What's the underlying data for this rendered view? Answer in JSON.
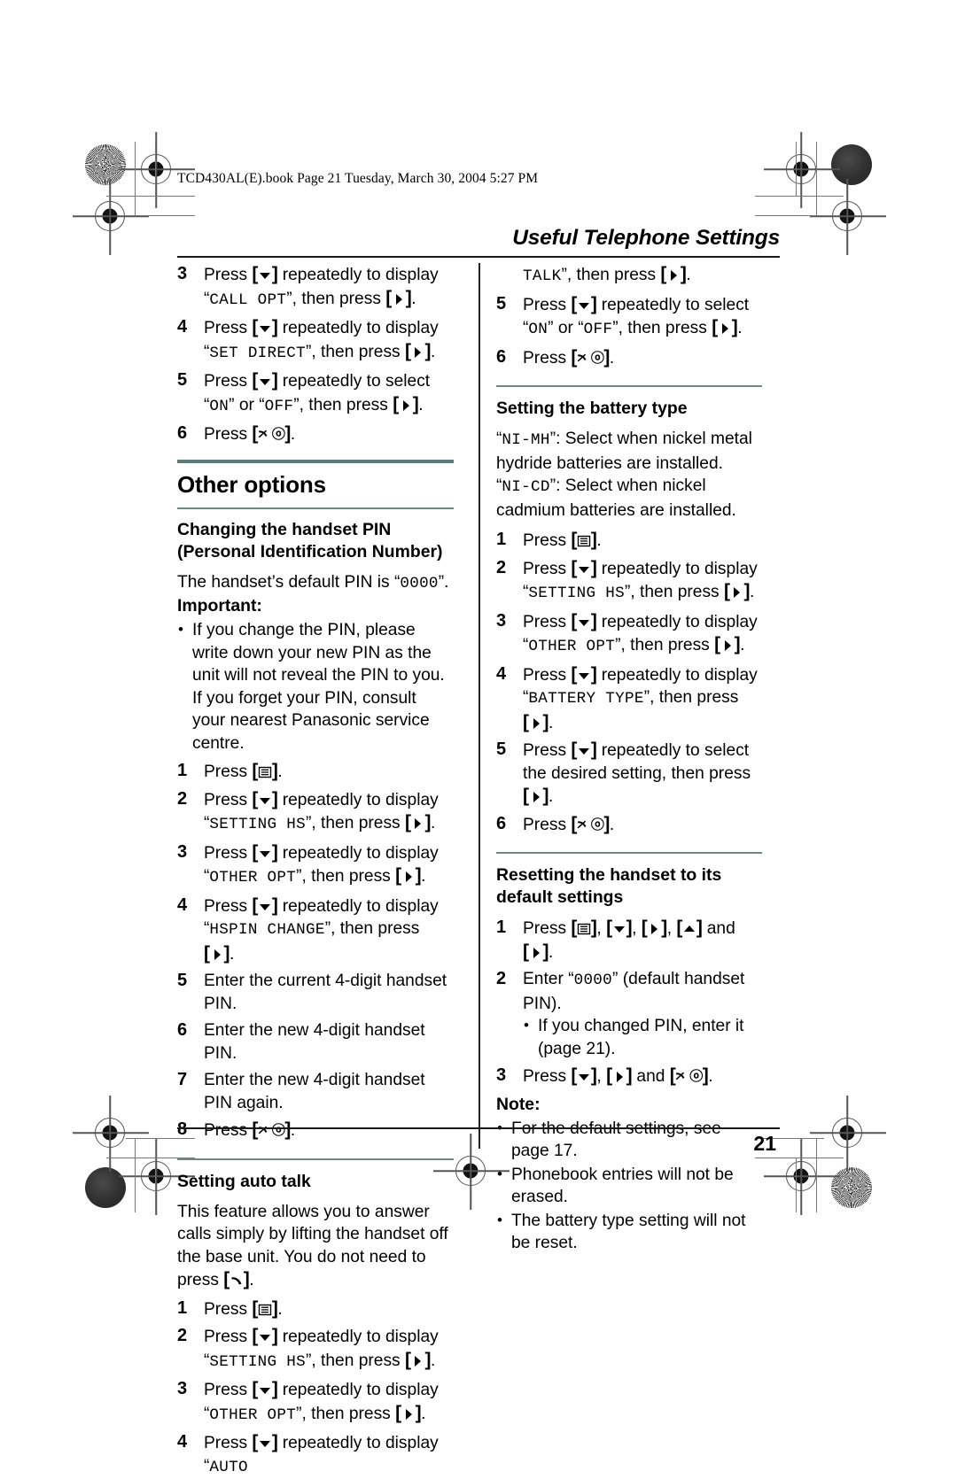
{
  "print": {
    "file_line": "TCD430AL(E).book  Page 21  Tuesday, March 30, 2004  5:27 PM",
    "page_number": "21",
    "running_head": "Useful Telephone Settings"
  },
  "keys": {
    "down": "[▼]",
    "up": "[▲]",
    "right": "[▶]",
    "menu": "[▤]",
    "talk": "[✆]",
    "off": "[✂⏻]"
  },
  "left_column": {
    "continued_steps": [
      {
        "num": "3",
        "parts": [
          {
            "t": "text",
            "v": "Press "
          },
          {
            "t": "key",
            "v": "down"
          },
          {
            "t": "text",
            "v": " repeatedly to display “"
          },
          {
            "t": "mono",
            "v": "CALL OPT"
          },
          {
            "t": "text",
            "v": "”, then press "
          },
          {
            "t": "key",
            "v": "right"
          },
          {
            "t": "text",
            "v": "."
          }
        ]
      },
      {
        "num": "4",
        "parts": [
          {
            "t": "text",
            "v": "Press "
          },
          {
            "t": "key",
            "v": "down"
          },
          {
            "t": "text",
            "v": " repeatedly to display “"
          },
          {
            "t": "mono",
            "v": "SET DIRECT"
          },
          {
            "t": "text",
            "v": "”, then press "
          },
          {
            "t": "key",
            "v": "right"
          },
          {
            "t": "text",
            "v": "."
          }
        ]
      },
      {
        "num": "5",
        "parts": [
          {
            "t": "text",
            "v": "Press "
          },
          {
            "t": "key",
            "v": "down"
          },
          {
            "t": "text",
            "v": " repeatedly to select “"
          },
          {
            "t": "mono",
            "v": "ON"
          },
          {
            "t": "text",
            "v": "” or “"
          },
          {
            "t": "mono",
            "v": "OFF"
          },
          {
            "t": "text",
            "v": "”, then press "
          },
          {
            "t": "key",
            "v": "right"
          },
          {
            "t": "text",
            "v": "."
          }
        ]
      },
      {
        "num": "6",
        "parts": [
          {
            "t": "text",
            "v": "Press "
          },
          {
            "t": "key",
            "v": "off"
          },
          {
            "t": "text",
            "v": "."
          }
        ]
      }
    ],
    "section_title": "Other options",
    "pin_section": {
      "heading": "Changing the handset PIN (Personal Identification Number)",
      "intro_parts": [
        {
          "t": "text",
          "v": "The handset’s default PIN is “"
        },
        {
          "t": "mono",
          "v": "0000"
        },
        {
          "t": "text",
          "v": "”."
        }
      ],
      "important_label": "Important:",
      "important_bullets": [
        "If you change the PIN, please write down your new PIN as the unit will not reveal the PIN to you. If you forget your PIN, consult your nearest Panasonic service centre."
      ],
      "steps": [
        {
          "num": "1",
          "parts": [
            {
              "t": "text",
              "v": "Press "
            },
            {
              "t": "key",
              "v": "menu"
            },
            {
              "t": "text",
              "v": "."
            }
          ]
        },
        {
          "num": "2",
          "parts": [
            {
              "t": "text",
              "v": "Press "
            },
            {
              "t": "key",
              "v": "down"
            },
            {
              "t": "text",
              "v": " repeatedly to display “"
            },
            {
              "t": "mono",
              "v": "SETTING HS"
            },
            {
              "t": "text",
              "v": "”, then press "
            },
            {
              "t": "key",
              "v": "right"
            },
            {
              "t": "text",
              "v": "."
            }
          ]
        },
        {
          "num": "3",
          "parts": [
            {
              "t": "text",
              "v": "Press "
            },
            {
              "t": "key",
              "v": "down"
            },
            {
              "t": "text",
              "v": " repeatedly to display “"
            },
            {
              "t": "mono",
              "v": "OTHER OPT"
            },
            {
              "t": "text",
              "v": "”, then press "
            },
            {
              "t": "key",
              "v": "right"
            },
            {
              "t": "text",
              "v": "."
            }
          ]
        },
        {
          "num": "4",
          "parts": [
            {
              "t": "text",
              "v": "Press "
            },
            {
              "t": "key",
              "v": "down"
            },
            {
              "t": "text",
              "v": " repeatedly to display “"
            },
            {
              "t": "mono",
              "v": "HSPIN CHANGE"
            },
            {
              "t": "text",
              "v": "”, then press "
            },
            {
              "t": "key",
              "v": "right"
            },
            {
              "t": "text",
              "v": "."
            }
          ]
        },
        {
          "num": "5",
          "parts": [
            {
              "t": "text",
              "v": "Enter the current 4-digit handset PIN."
            }
          ]
        },
        {
          "num": "6",
          "parts": [
            {
              "t": "text",
              "v": "Enter the new 4-digit handset PIN."
            }
          ]
        },
        {
          "num": "7",
          "parts": [
            {
              "t": "text",
              "v": "Enter the new 4-digit handset PIN again."
            }
          ]
        },
        {
          "num": "8",
          "parts": [
            {
              "t": "text",
              "v": "Press "
            },
            {
              "t": "key",
              "v": "off"
            },
            {
              "t": "text",
              "v": "."
            }
          ]
        }
      ]
    },
    "auto_talk_section": {
      "heading": "Setting auto talk",
      "intro_parts": [
        {
          "t": "text",
          "v": "This feature allows you to answer calls simply by lifting the handset off the base unit. You do not need to press "
        },
        {
          "t": "key",
          "v": "talk"
        },
        {
          "t": "text",
          "v": "."
        }
      ],
      "steps": [
        {
          "num": "1",
          "parts": [
            {
              "t": "text",
              "v": "Press "
            },
            {
              "t": "key",
              "v": "menu"
            },
            {
              "t": "text",
              "v": "."
            }
          ]
        },
        {
          "num": "2",
          "parts": [
            {
              "t": "text",
              "v": "Press "
            },
            {
              "t": "key",
              "v": "down"
            },
            {
              "t": "text",
              "v": " repeatedly to display “"
            },
            {
              "t": "mono",
              "v": "SETTING HS"
            },
            {
              "t": "text",
              "v": "”, then press "
            },
            {
              "t": "key",
              "v": "right"
            },
            {
              "t": "text",
              "v": "."
            }
          ]
        },
        {
          "num": "3",
          "parts": [
            {
              "t": "text",
              "v": "Press "
            },
            {
              "t": "key",
              "v": "down"
            },
            {
              "t": "text",
              "v": " repeatedly to display “"
            },
            {
              "t": "mono",
              "v": "OTHER OPT"
            },
            {
              "t": "text",
              "v": "”, then press "
            },
            {
              "t": "key",
              "v": "right"
            },
            {
              "t": "text",
              "v": "."
            }
          ]
        },
        {
          "num": "4",
          "parts": [
            {
              "t": "text",
              "v": "Press "
            },
            {
              "t": "key",
              "v": "down"
            },
            {
              "t": "text",
              "v": " repeatedly to display “"
            },
            {
              "t": "mono",
              "v": "AUTO"
            }
          ]
        }
      ]
    }
  },
  "right_column": {
    "continued_steps": [
      {
        "num": "",
        "indent": true,
        "parts": [
          {
            "t": "mono",
            "v": "TALK"
          },
          {
            "t": "text",
            "v": "”, then press "
          },
          {
            "t": "key",
            "v": "right"
          },
          {
            "t": "text",
            "v": "."
          }
        ]
      },
      {
        "num": "5",
        "parts": [
          {
            "t": "text",
            "v": "Press "
          },
          {
            "t": "key",
            "v": "down"
          },
          {
            "t": "text",
            "v": " repeatedly to select “"
          },
          {
            "t": "mono",
            "v": "ON"
          },
          {
            "t": "text",
            "v": "” or “"
          },
          {
            "t": "mono",
            "v": "OFF"
          },
          {
            "t": "text",
            "v": "”, then press "
          },
          {
            "t": "key",
            "v": "right"
          },
          {
            "t": "text",
            "v": "."
          }
        ]
      },
      {
        "num": "6",
        "parts": [
          {
            "t": "text",
            "v": "Press "
          },
          {
            "t": "key",
            "v": "off"
          },
          {
            "t": "text",
            "v": "."
          }
        ]
      }
    ],
    "battery_section": {
      "heading": "Setting the battery type",
      "desc_lines": [
        [
          {
            "t": "text",
            "v": "“"
          },
          {
            "t": "mono",
            "v": "NI-MH"
          },
          {
            "t": "text",
            "v": "”: Select when nickel metal hydride batteries are installed."
          }
        ],
        [
          {
            "t": "text",
            "v": "“"
          },
          {
            "t": "mono",
            "v": "NI-CD"
          },
          {
            "t": "text",
            "v": "”: Select when nickel cadmium batteries are installed."
          }
        ]
      ],
      "steps": [
        {
          "num": "1",
          "parts": [
            {
              "t": "text",
              "v": "Press "
            },
            {
              "t": "key",
              "v": "menu"
            },
            {
              "t": "text",
              "v": "."
            }
          ]
        },
        {
          "num": "2",
          "parts": [
            {
              "t": "text",
              "v": "Press "
            },
            {
              "t": "key",
              "v": "down"
            },
            {
              "t": "text",
              "v": " repeatedly to display “"
            },
            {
              "t": "mono",
              "v": "SETTING HS"
            },
            {
              "t": "text",
              "v": "”, then press "
            },
            {
              "t": "key",
              "v": "right"
            },
            {
              "t": "text",
              "v": "."
            }
          ]
        },
        {
          "num": "3",
          "parts": [
            {
              "t": "text",
              "v": "Press "
            },
            {
              "t": "key",
              "v": "down"
            },
            {
              "t": "text",
              "v": " repeatedly to display “"
            },
            {
              "t": "mono",
              "v": "OTHER OPT"
            },
            {
              "t": "text",
              "v": "”, then press "
            },
            {
              "t": "key",
              "v": "right"
            },
            {
              "t": "text",
              "v": "."
            }
          ]
        },
        {
          "num": "4",
          "parts": [
            {
              "t": "text",
              "v": "Press "
            },
            {
              "t": "key",
              "v": "down"
            },
            {
              "t": "text",
              "v": " repeatedly to display “"
            },
            {
              "t": "mono",
              "v": "BATTERY TYPE"
            },
            {
              "t": "text",
              "v": "”, then press "
            },
            {
              "t": "key",
              "v": "right"
            },
            {
              "t": "text",
              "v": "."
            }
          ]
        },
        {
          "num": "5",
          "parts": [
            {
              "t": "text",
              "v": "Press "
            },
            {
              "t": "key",
              "v": "down"
            },
            {
              "t": "text",
              "v": " repeatedly to select the desired setting, then press "
            },
            {
              "t": "key",
              "v": "right"
            },
            {
              "t": "text",
              "v": "."
            }
          ]
        },
        {
          "num": "6",
          "parts": [
            {
              "t": "text",
              "v": "Press "
            },
            {
              "t": "key",
              "v": "off"
            },
            {
              "t": "text",
              "v": "."
            }
          ]
        }
      ]
    },
    "reset_section": {
      "heading": "Resetting the handset to its default settings",
      "steps": [
        {
          "num": "1",
          "parts": [
            {
              "t": "text",
              "v": "Press "
            },
            {
              "t": "key",
              "v": "menu"
            },
            {
              "t": "text",
              "v": ", "
            },
            {
              "t": "key",
              "v": "down"
            },
            {
              "t": "text",
              "v": ", "
            },
            {
              "t": "key",
              "v": "right"
            },
            {
              "t": "text",
              "v": ", "
            },
            {
              "t": "key",
              "v": "up"
            },
            {
              "t": "text",
              "v": " and "
            },
            {
              "t": "key",
              "v": "right"
            },
            {
              "t": "text",
              "v": "."
            }
          ]
        },
        {
          "num": "2",
          "parts": [
            {
              "t": "text",
              "v": "Enter “"
            },
            {
              "t": "mono",
              "v": "0000"
            },
            {
              "t": "text",
              "v": "” (default handset PIN)."
            }
          ],
          "sub_bullets": [
            "If you changed PIN, enter it (page 21)."
          ]
        },
        {
          "num": "3",
          "parts": [
            {
              "t": "text",
              "v": "Press "
            },
            {
              "t": "key",
              "v": "down"
            },
            {
              "t": "text",
              "v": ", "
            },
            {
              "t": "key",
              "v": "right"
            },
            {
              "t": "text",
              "v": " and "
            },
            {
              "t": "key",
              "v": "off"
            },
            {
              "t": "text",
              "v": "."
            }
          ]
        }
      ],
      "note_label": "Note:",
      "note_bullets": [
        "For the default settings, see page 17.",
        "Phonebook entries will not be erased.",
        "The battery type setting will not be reset."
      ]
    }
  }
}
